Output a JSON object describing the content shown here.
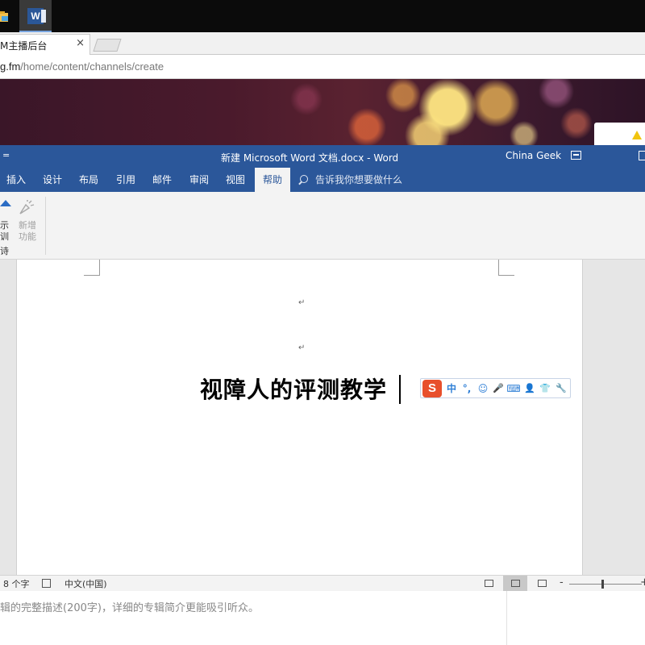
{
  "browser": {
    "tab_title": "M主播后台",
    "tab_close": "×",
    "url_host": "g.fm",
    "url_path": "/home/content/channels/create"
  },
  "word": {
    "qat_glyph": "=",
    "title": "新建 Microsoft Word 文档.docx  -  Word",
    "account": "China Geek",
    "tabs": [
      {
        "label": "插入"
      },
      {
        "label": "设计"
      },
      {
        "label": "布局"
      },
      {
        "label": "引用"
      },
      {
        "label": "邮件"
      },
      {
        "label": "审阅"
      },
      {
        "label": "视图"
      },
      {
        "label": "帮助"
      }
    ],
    "tell_me": "告诉我你想要做什么",
    "ribbon": {
      "tutorial_line1": "示",
      "tutorial_line2": "训",
      "tutorial_line3": "诗",
      "new_features_line1": "新增",
      "new_features_line2": "功能"
    },
    "document": {
      "paragraph_mark": "↵",
      "heading": "视障人的评测教学"
    },
    "ime": {
      "logo": "S",
      "mode": "中",
      "punct": "°,",
      "emoji": "☺",
      "voice": "🎤",
      "keyboard": "⌨",
      "user": "👤",
      "skin": "👕",
      "tools": "🔧"
    },
    "status": {
      "word_count": "8 个字",
      "language": "中文(中国)"
    }
  },
  "web": {
    "description_hint": "辑的完整描述(200字)，详细的专辑简介更能吸引听众。"
  }
}
